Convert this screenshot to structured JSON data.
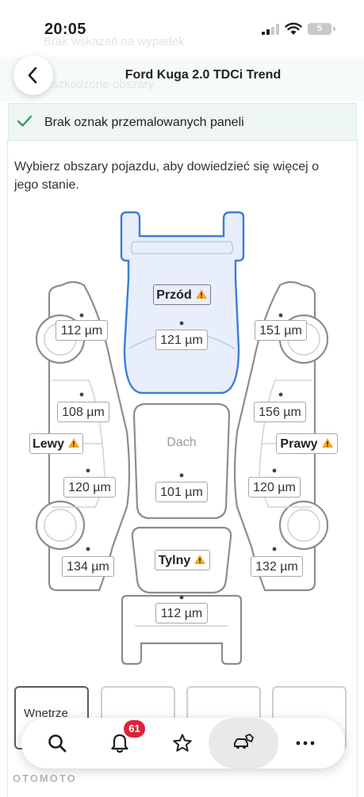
{
  "status_bar": {
    "time": "20:05",
    "battery": "5"
  },
  "header": {
    "title": "Ford Kuga 2.0 TDCi Trend",
    "ghost_line_1": "Brak wskazań na wypadek",
    "ghost_line_2": "Uszkodzone obszary"
  },
  "paint_banner": {
    "text": "Brak oznak przemalowanych paneli",
    "status": "ok"
  },
  "instruction": "Wybierz obszary pojazdu, aby dowiedzieć się więcej o jego stanie.",
  "areas": {
    "front": {
      "label": "Przód",
      "warning": true,
      "selected": true
    },
    "roof": {
      "label": "Dach",
      "warning": false
    },
    "rear": {
      "label": "Tylny",
      "warning": true
    },
    "left": {
      "label": "Lewy",
      "warning": true
    },
    "right": {
      "label": "Prawy",
      "warning": true
    }
  },
  "measurements": {
    "front_hood": "121 µm",
    "roof": "101 µm",
    "rear_bumper": "112 µm",
    "left_front_fender": "112 µm",
    "left_front_door": "108 µm",
    "left_rear_door": "120 µm",
    "left_rear_quarter": "134 µm",
    "right_front_fender": "151 µm",
    "right_front_door": "156 µm",
    "right_rear_door": "120 µm",
    "right_rear_quarter": "132 µm"
  },
  "tabs": [
    {
      "label": "Wnetrze"
    },
    {
      "label": ""
    },
    {
      "label": ""
    },
    {
      "label": ""
    }
  ],
  "bottom_nav": {
    "items": [
      {
        "name": "search",
        "icon": "search-icon"
      },
      {
        "name": "notifications",
        "icon": "bell-icon",
        "badge": "61"
      },
      {
        "name": "favorites",
        "icon": "star-icon"
      },
      {
        "name": "my-car",
        "icon": "car-tag-icon",
        "active": true
      },
      {
        "name": "more",
        "icon": "more-icon"
      }
    ]
  },
  "watermark": "OTOMOTO",
  "colors": {
    "accent_blue": "#3b7dd8",
    "front_fill": "#e8eefb",
    "success_green": "#2e9e5e",
    "warning_amber": "#f2a81d",
    "badge_red": "#d9253a"
  }
}
